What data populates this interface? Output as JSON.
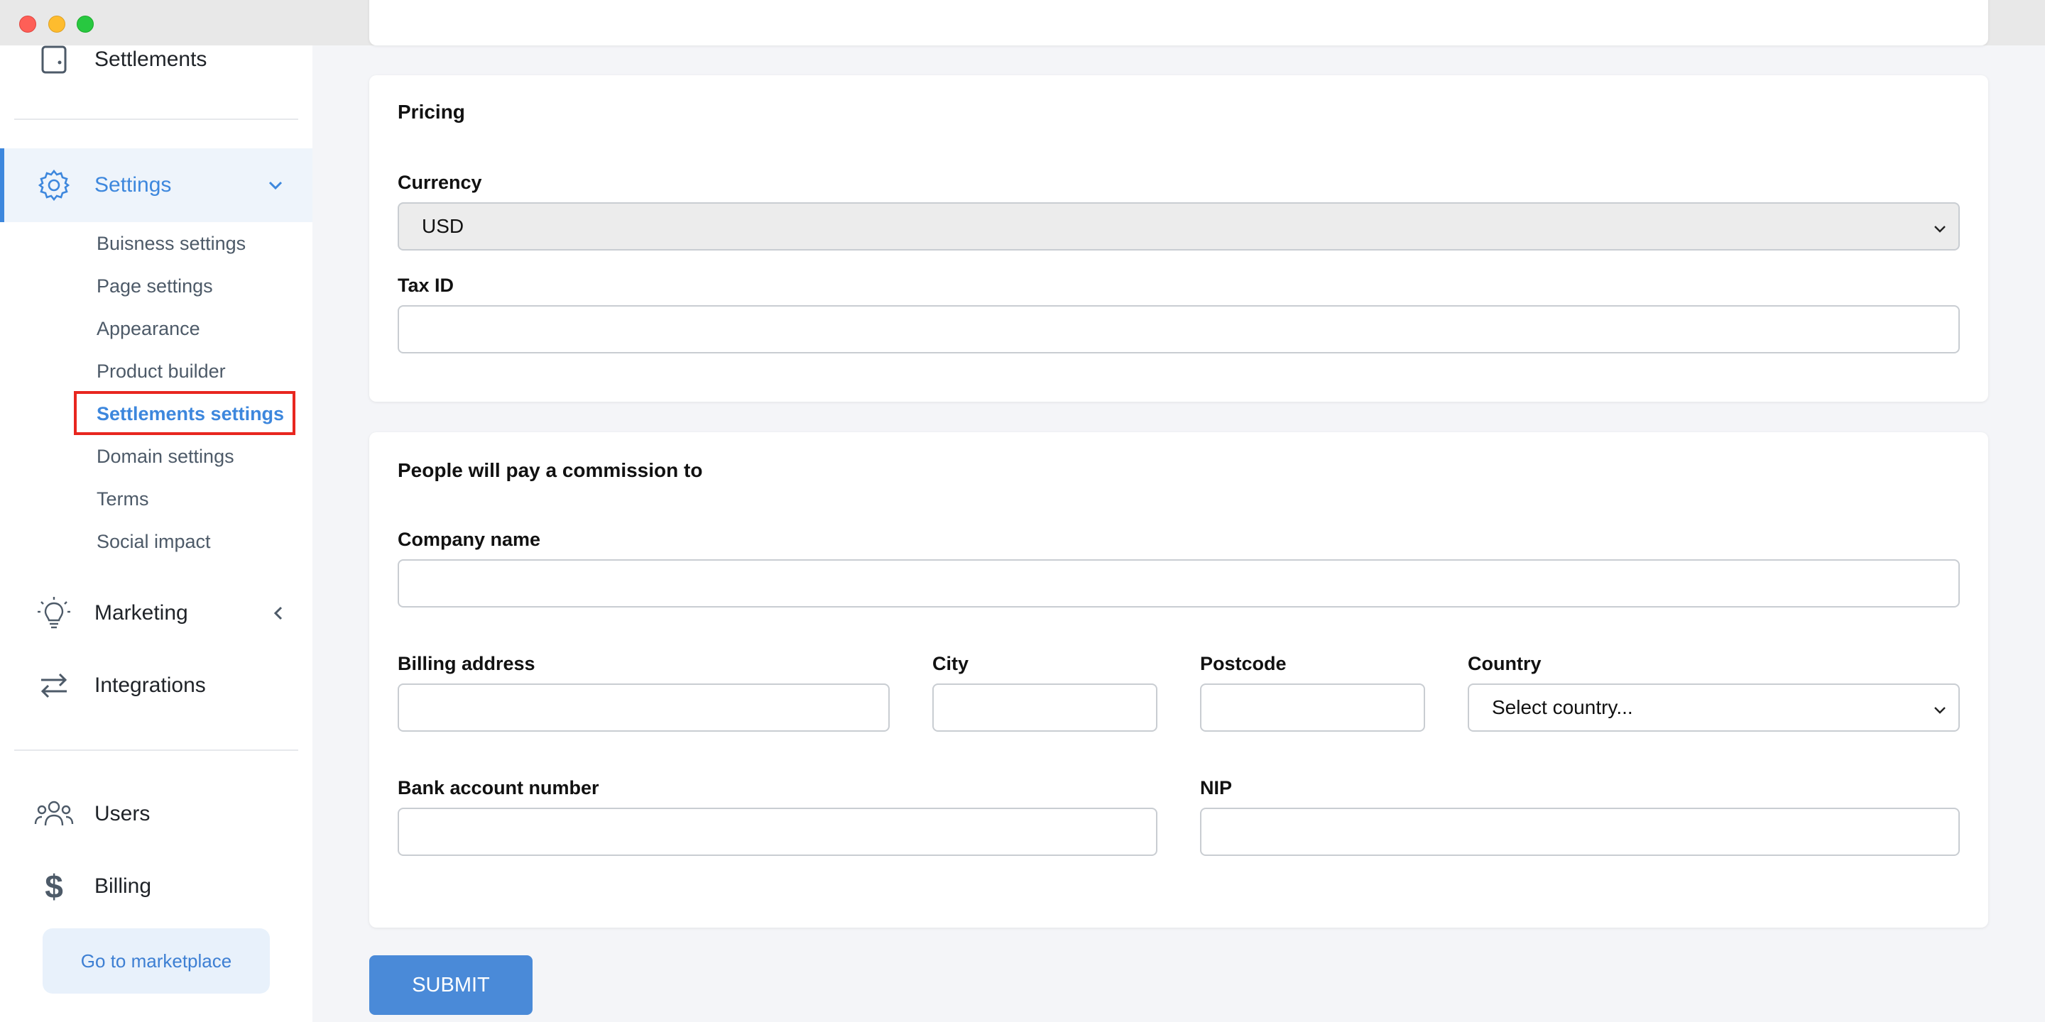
{
  "sidebar": {
    "settlements_label": "Settlements",
    "settings_label": "Settings",
    "settings_sub": [
      "Buisness settings",
      "Page settings",
      "Appearance",
      "Product builder",
      "Settlements settings",
      "Domain settings",
      "Terms",
      "Social impact"
    ],
    "active_sub": "Settlements settings",
    "marketing_label": "Marketing",
    "integrations_label": "Integrations",
    "users_label": "Users",
    "billing_label": "Billing",
    "marketplace_button": "Go to marketplace"
  },
  "pricing": {
    "title": "Pricing",
    "currency_label": "Currency",
    "currency_value": "USD",
    "tax_id_label": "Tax ID",
    "tax_id_value": ""
  },
  "commission": {
    "title": "People will pay a commission to",
    "company_name_label": "Company name",
    "billing_address_label": "Billing address",
    "city_label": "City",
    "postcode_label": "Postcode",
    "country_label": "Country",
    "country_value": "Select country...",
    "bank_account_label": "Bank account number",
    "nip_label": "NIP"
  },
  "submit_label": "SUBMIT",
  "colors": {
    "accent": "#3d87dd",
    "submit": "#4a8ad8",
    "highlight": "#e8261f"
  }
}
